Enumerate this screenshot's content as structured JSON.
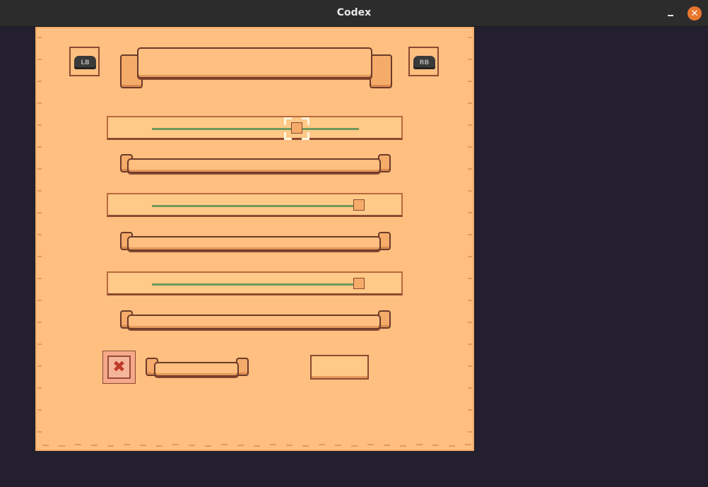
{
  "window": {
    "title": "Codex",
    "minimize_icon": "minimize-icon",
    "close_icon": "close-icon",
    "close_glyph": "✕"
  },
  "game": {
    "left_shoulder_label": "LB",
    "right_shoulder_label": "RB",
    "sliders": [
      {
        "value_fraction": 0.7,
        "selected": true
      },
      {
        "value_fraction": 1.0,
        "selected": false
      },
      {
        "value_fraction": 1.0,
        "selected": false
      }
    ],
    "close_glyph": "✖",
    "colors": {
      "background": "#231f2f",
      "parchment": "#ffbf80",
      "track": "#6f9a5c",
      "close_accent": "#e8772e"
    }
  }
}
